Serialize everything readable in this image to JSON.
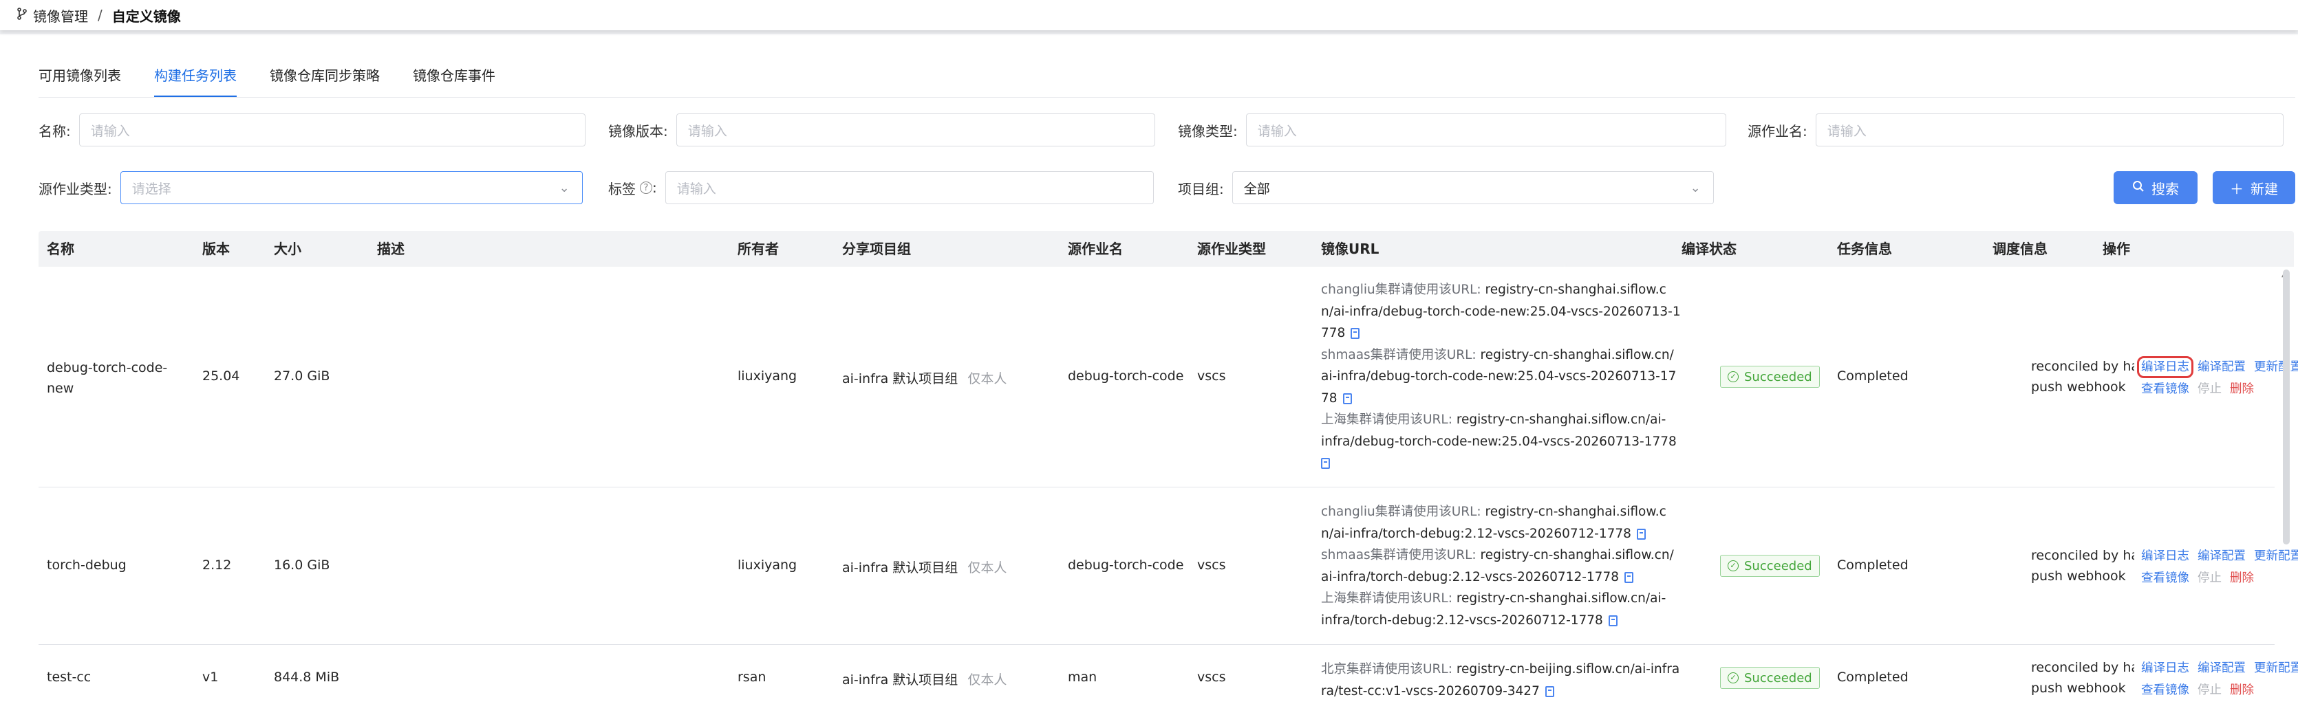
{
  "breadcrumb": {
    "parent": "镜像管理",
    "separator": "/",
    "current": "自定义镜像"
  },
  "tabs": [
    {
      "label": "可用镜像列表",
      "active": false
    },
    {
      "label": "构建任务列表",
      "active": true
    },
    {
      "label": "镜像仓库同步策略",
      "active": false
    },
    {
      "label": "镜像仓库事件",
      "active": false
    }
  ],
  "filters": {
    "name": {
      "label": "名称:",
      "placeholder": "请输入"
    },
    "version": {
      "label": "镜像版本:",
      "placeholder": "请输入"
    },
    "image_type": {
      "label": "镜像类型:",
      "placeholder": "请输入"
    },
    "source_job": {
      "label": "源作业名:",
      "placeholder": "请输入"
    },
    "source_job_type": {
      "label": "源作业类型:",
      "placeholder": "请选择"
    },
    "tag": {
      "label": "标签",
      "placeholder": "请输入"
    },
    "project_group": {
      "label": "项目组:",
      "value": "全部"
    }
  },
  "buttons": {
    "search": "搜索",
    "create": "新建"
  },
  "table": {
    "headers": [
      "名称",
      "版本",
      "大小",
      "描述",
      "所有者",
      "分享项目组",
      "源作业名",
      "源作业类型",
      "镜像URL",
      "编译状态",
      "任务信息",
      "调度信息",
      "操作"
    ],
    "rows": [
      {
        "name_line1": "debug-torch-code-",
        "name_line2": "new",
        "version": "25.04",
        "size": "27.0 GiB",
        "owner": "liuxiyang",
        "group": "ai-infra 默认项目组",
        "group_note": "仅本人",
        "source_job": "debug-torch-code",
        "source_type": "vscs",
        "urls": [
          {
            "label": "changliu集群请使用该URL: ",
            "lines": [
              "registry-cn-shanghai.siflow.c",
              "n/ai-infra/debug-torch-code-new:25.04-vscs-20260713-1",
              "778"
            ]
          },
          {
            "label": "shmaas集群请使用该URL: ",
            "lines": [
              "registry-cn-shanghai.siflow.cn/",
              "ai-infra/debug-torch-code-new:25.04-vscs-20260713-17",
              "78"
            ]
          },
          {
            "label": "上海集群请使用该URL: ",
            "lines": [
              "registry-cn-shanghai.siflow.cn/ai-",
              "infra/debug-torch-code-new:25.04-vscs-20260713-1778",
              ""
            ]
          }
        ],
        "status": "Succeeded",
        "task": "Completed",
        "sched_line1": "reconciled by har",
        "sched_line2": "push webhook"
      },
      {
        "name_line1": "torch-debug",
        "name_line2": "",
        "version": "2.12",
        "size": "16.0 GiB",
        "owner": "liuxiyang",
        "group": "ai-infra 默认项目组",
        "group_note": "仅本人",
        "source_job": "debug-torch-code",
        "source_type": "vscs",
        "urls": [
          {
            "label": "changliu集群请使用该URL: ",
            "lines": [
              "registry-cn-shanghai.siflow.c",
              "n/ai-infra/torch-debug:2.12-vscs-20260712-1778"
            ]
          },
          {
            "label": "shmaas集群请使用该URL: ",
            "lines": [
              "registry-cn-shanghai.siflow.cn/",
              "ai-infra/torch-debug:2.12-vscs-20260712-1778"
            ]
          },
          {
            "label": "上海集群请使用该URL: ",
            "lines": [
              "registry-cn-shanghai.siflow.cn/ai-",
              "infra/torch-debug:2.12-vscs-20260712-1778"
            ]
          }
        ],
        "status": "Succeeded",
        "task": "Completed",
        "sched_line1": "reconciled by har",
        "sched_line2": "push webhook"
      },
      {
        "name_line1": "test-cc",
        "name_line2": "",
        "version": "v1",
        "size": "844.8 MiB",
        "owner": "rsan",
        "group": "ai-infra 默认项目组",
        "group_note": "仅本人",
        "source_job": "man",
        "source_type": "vscs",
        "urls": [
          {
            "label": "北京集群请使用该URL: ",
            "lines": [
              "registry-cn-beijing.siflow.cn/ai-infra",
              "ra/test-cc:v1-vscs-20260709-3427"
            ]
          }
        ],
        "status": "Succeeded",
        "task": "Completed",
        "sched_line1": "reconciled by har",
        "sched_line2": "push webhook"
      }
    ]
  },
  "actions": {
    "compile_log": "编译日志",
    "compile_config": "编译配置",
    "update_config": "更新配置",
    "view_image": "查看镜像",
    "stop": "停止",
    "delete": "删除"
  },
  "colors": {
    "accent": "#1f6fe5",
    "button": "#4a84f0",
    "success": "#43a63a",
    "danger": "#e04c4c",
    "highlight": "#e03c3c"
  }
}
